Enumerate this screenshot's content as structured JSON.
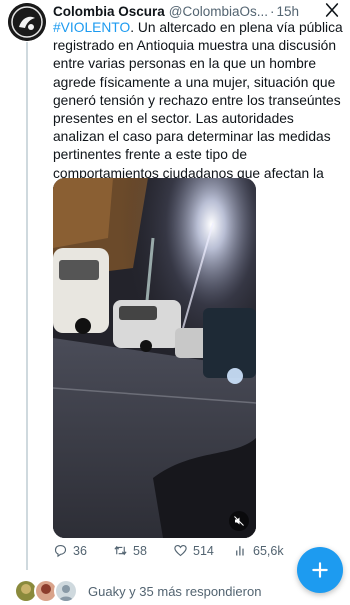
{
  "tweet": {
    "author_name": "Colombia Oscura",
    "author_handle": "@ColombiaOs...",
    "separator": "·",
    "time": "15h",
    "hashtag": "#VIOLENTO",
    "body": ". Un altercado en plena vía pública registrado en Antioquia muestra una discusión entre varias personas en la que un hombre agrede físicamente a una mujer, situación que generó tensión y rechazo entre los transeúntes presentes en el sector. Las autoridades analizan el caso para determinar las medidas pertinentes frente a este tipo de comportamientos ciudadanos que afectan la convivencia."
  },
  "actions": {
    "replies": "36",
    "retweets": "58",
    "likes": "514",
    "views": "65,6k"
  },
  "replies_summary": "Guaky y 35 más respondieron",
  "colors": {
    "accent": "#1d9bf0",
    "text": "#0f1419",
    "muted": "#536471"
  },
  "icons": [
    "close-x-icon",
    "mute-icon",
    "reply-icon",
    "retweet-icon",
    "like-icon",
    "views-icon",
    "compose-plus-icon"
  ]
}
